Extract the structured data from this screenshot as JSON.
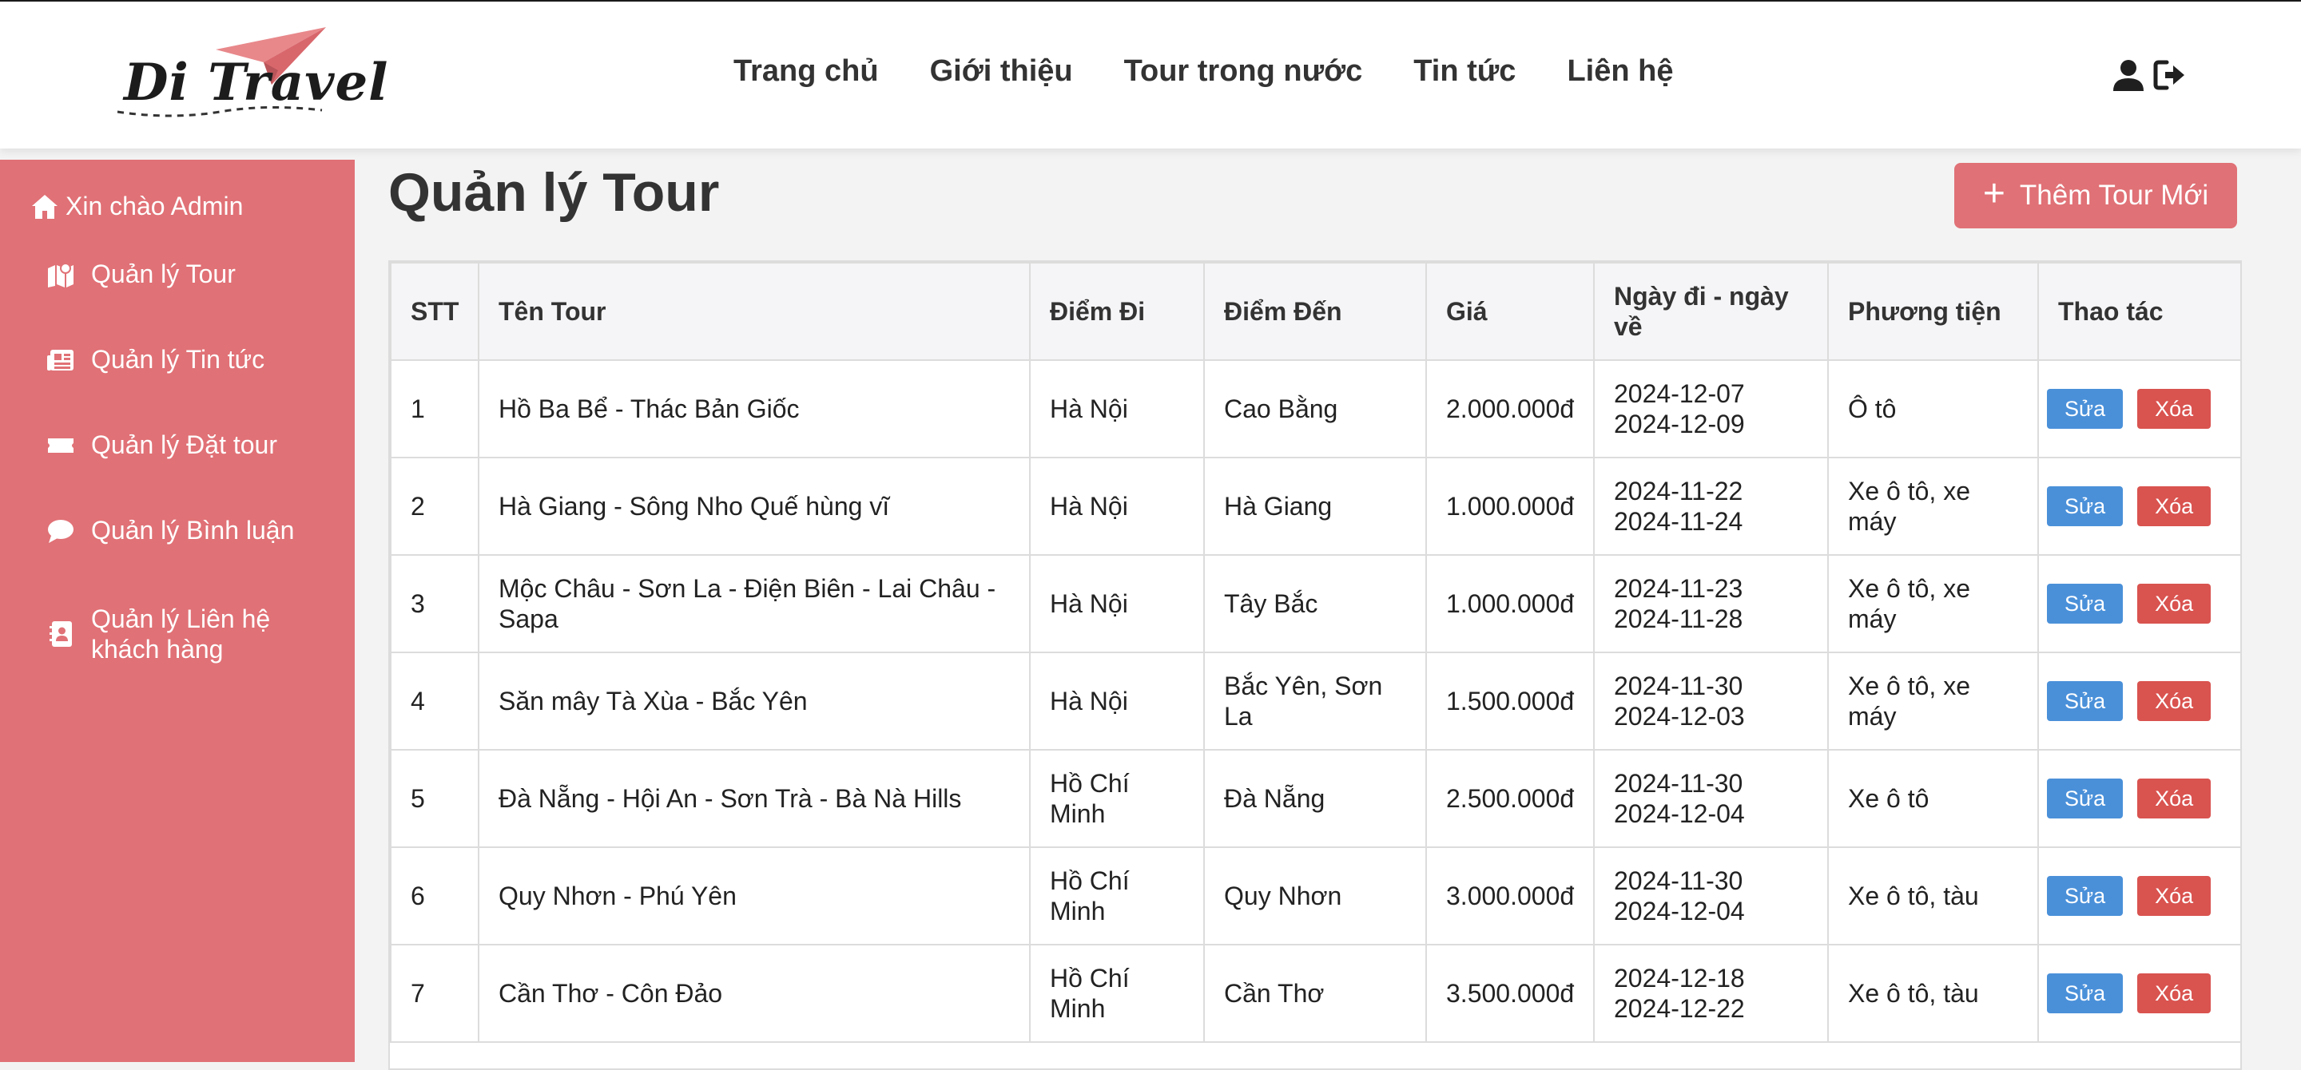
{
  "brand": {
    "logo_text": "Di Travel"
  },
  "nav": {
    "items": [
      "Trang chủ",
      "Giới thiệu",
      "Tour trong nước",
      "Tin tức",
      "Liên hệ"
    ]
  },
  "header_icons": [
    "user-icon",
    "logout-icon"
  ],
  "sidebar": {
    "welcome": "Xin chào Admin",
    "items": [
      {
        "label": "Quản lý Tour",
        "icon": "map-icon"
      },
      {
        "label": "Quản lý Tin tức",
        "icon": "newspaper-icon"
      },
      {
        "label": "Quản lý Đặt tour",
        "icon": "ticket-icon"
      },
      {
        "label": "Quản lý Bình luận",
        "icon": "comment-icon"
      },
      {
        "label": "Quản lý Liên hệ khách hàng",
        "icon": "contact-icon"
      }
    ]
  },
  "page": {
    "title": "Quản lý Tour",
    "add_button": "Thêm Tour Mới"
  },
  "table": {
    "headers": [
      "STT",
      "Tên Tour",
      "Điểm Đi",
      "Điểm Đến",
      "Giá",
      "Ngày đi - ngày về",
      "Phương tiện",
      "Thao tác"
    ],
    "edit_label": "Sửa",
    "delete_label": "Xóa",
    "rows": [
      {
        "stt": "1",
        "name": "Hồ Ba Bể - Thác Bản Giốc",
        "from": "Hà Nội",
        "to": "Cao Bằng",
        "price": "2.000.000đ",
        "start": "2024-12-07",
        "end": "2024-12-09",
        "transport": "Ô tô"
      },
      {
        "stt": "2",
        "name": "Hà Giang - Sông Nho Quế hùng vĩ",
        "from": "Hà Nội",
        "to": "Hà Giang",
        "price": "1.000.000đ",
        "start": "2024-11-22",
        "end": "2024-11-24",
        "transport": "Xe ô tô, xe máy"
      },
      {
        "stt": "3",
        "name": "Mộc Châu - Sơn La - Điện Biên - Lai Châu - Sapa",
        "from": "Hà Nội",
        "to": "Tây Bắc",
        "price": "1.000.000đ",
        "start": "2024-11-23",
        "end": "2024-11-28",
        "transport": "Xe ô tô, xe máy"
      },
      {
        "stt": "4",
        "name": "Săn mây Tà Xùa - Bắc Yên",
        "from": "Hà Nội",
        "to": "Bắc Yên, Sơn La",
        "price": "1.500.000đ",
        "start": "2024-11-30",
        "end": "2024-12-03",
        "transport": "Xe ô tô, xe máy"
      },
      {
        "stt": "5",
        "name": "Đà Nẵng - Hội An - Sơn Trà - Bà Nà Hills",
        "from": "Hồ Chí Minh",
        "to": "Đà Nẵng",
        "price": "2.500.000đ",
        "start": "2024-11-30",
        "end": "2024-12-04",
        "transport": "Xe ô tô"
      },
      {
        "stt": "6",
        "name": "Quy Nhơn - Phú Yên",
        "from": "Hồ Chí Minh",
        "to": "Quy Nhơn",
        "price": "3.000.000đ",
        "start": "2024-11-30",
        "end": "2024-12-04",
        "transport": "Xe ô tô, tàu"
      },
      {
        "stt": "7",
        "name": "Cần Thơ - Côn Đảo",
        "from": "Hồ Chí Minh",
        "to": "Cần Thơ",
        "price": "3.500.000đ",
        "start": "2024-12-18",
        "end": "2024-12-22",
        "transport": "Xe ô tô, tàu"
      }
    ]
  },
  "colors": {
    "accent": "#e07176",
    "edit_button": "#4a90d9",
    "delete_button": "#d9534f"
  }
}
